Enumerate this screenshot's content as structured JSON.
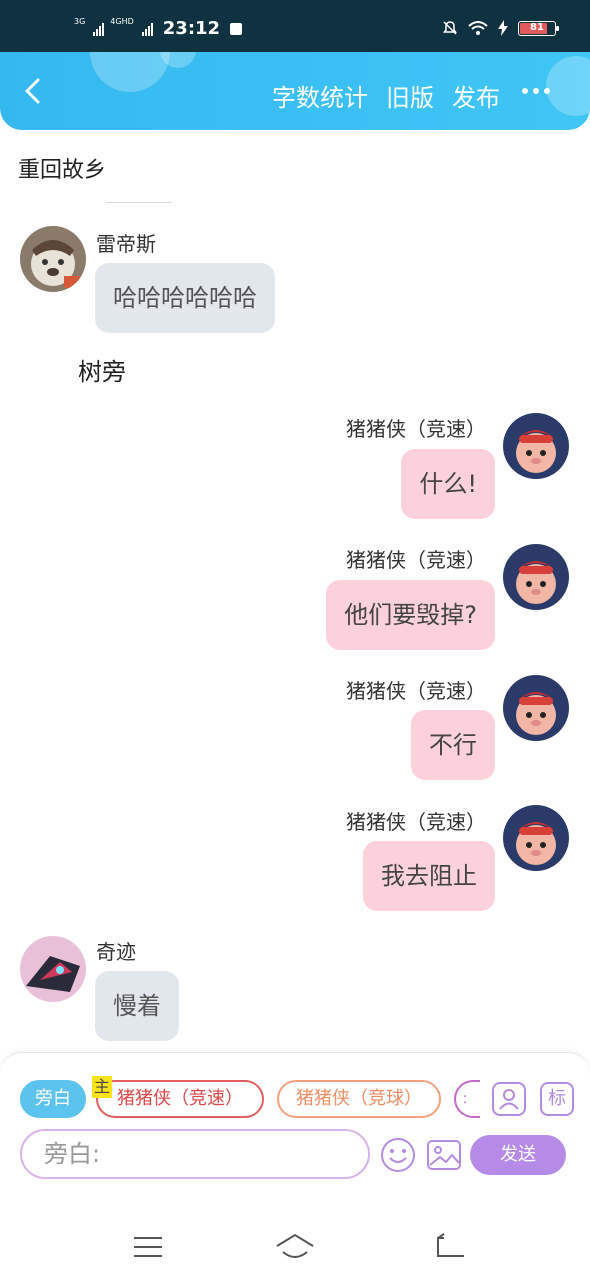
{
  "status": {
    "net1": "3G",
    "net2": "4GHD",
    "time": "23:12",
    "battery": "81"
  },
  "toolbar": {
    "word_count": "字数统计",
    "old_version": "旧版",
    "publish": "发布"
  },
  "chapter": {
    "title": "重回故乡"
  },
  "messages": [
    {
      "name": "雷帝斯",
      "text": "哈哈哈哈哈哈"
    },
    {
      "narration": "树旁"
    },
    {
      "name": "猪猪侠（竞速）",
      "text": "什么!"
    },
    {
      "name": "猪猪侠（竞速）",
      "text": "他们要毁掉?"
    },
    {
      "name": "猪猪侠（竞速）",
      "text": "不行"
    },
    {
      "name": "猪猪侠（竞速）",
      "text": "我去阻止"
    },
    {
      "name": "奇迹",
      "text": "慢着"
    }
  ],
  "composer": {
    "roles": [
      "旁白",
      "猪猪侠（竞速）",
      "猪猪侠（竞球）",
      "："
    ],
    "main_tag": "主",
    "mark_label": "标",
    "input_placeholder": "旁白:",
    "send_label": "发送"
  },
  "colors": {
    "header": "#35b8f0",
    "bubble_left": "#e2e7ee",
    "bubble_right": "#fdd1dc",
    "send": "#b68be8"
  }
}
